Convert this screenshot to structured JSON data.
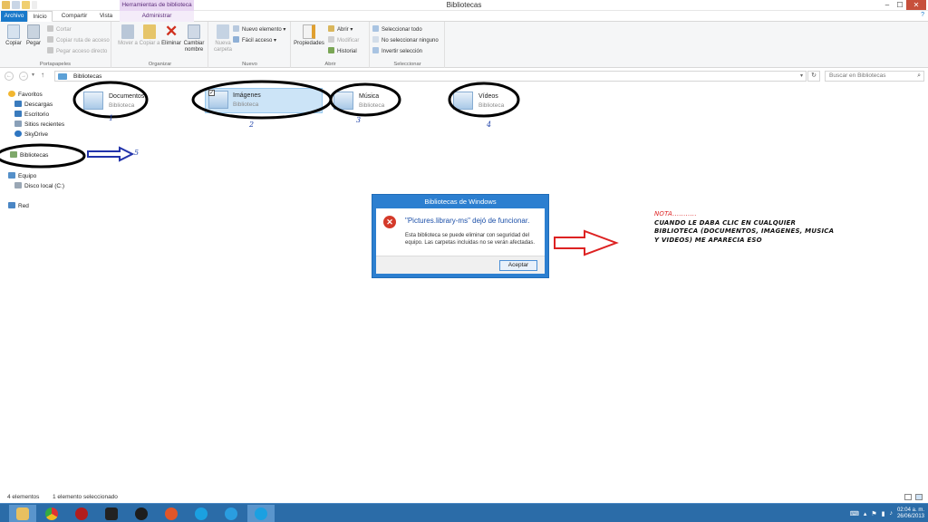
{
  "window": {
    "title": "Bibliotecas",
    "context_tab_header": "Herramientas de biblioteca",
    "minimize": "–",
    "maximize": "☐",
    "close": "✕"
  },
  "tabs": {
    "file": "Archivo",
    "home": "Inicio",
    "share": "Compartir",
    "view": "Vista",
    "manage": "Administrar",
    "help": "?"
  },
  "ribbon": {
    "clipboard": {
      "label": "Portapapeles",
      "copy": "Copiar",
      "paste": "Pegar",
      "cut": "Cortar",
      "copy_path": "Copiar ruta de acceso",
      "paste_shortcut": "Pegar acceso directo"
    },
    "organize": {
      "label": "Organizar",
      "move_to": "Mover a",
      "copy_to": "Copiar a",
      "delete": "Eliminar",
      "rename": "Cambiar nombre"
    },
    "new": {
      "label": "Nuevo",
      "new_folder": "Nueva carpeta",
      "new_item": "Nuevo elemento",
      "easy_access": "Fácil acceso"
    },
    "open": {
      "label": "Abrir",
      "properties": "Propiedades",
      "open": "Abrir",
      "edit": "Modificar",
      "history": "Historial"
    },
    "select": {
      "label": "Seleccionar",
      "select_all": "Seleccionar todo",
      "select_none": "No seleccionar ninguno",
      "invert": "Invertir selección"
    }
  },
  "address": {
    "path": "Bibliotecas",
    "search_placeholder": "Buscar en Bibliotecas"
  },
  "nav": {
    "favorites": "Favoritos",
    "downloads": "Descargas",
    "desktop": "Escritorio",
    "recent": "Sitios recientes",
    "skydrive": "SkyDrive",
    "libraries": "Bibliotecas",
    "computer": "Equipo",
    "local_disk": "Disco local (C:)",
    "network": "Red"
  },
  "libraries": [
    {
      "name": "Documentos",
      "type": "Biblioteca"
    },
    {
      "name": "Imágenes",
      "type": "Biblioteca"
    },
    {
      "name": "Música",
      "type": "Biblioteca"
    },
    {
      "name": "Vídeos",
      "type": "Biblioteca"
    }
  ],
  "annotations": {
    "n1": "1",
    "n2": "2",
    "n3": "3",
    "n4": "4",
    "n5": "5",
    "note_heading": "NOTA...........",
    "note_body": "CUANDO LE DABA CLIC EN CUALQUIER BIBLIOTECA (DOCUMENTOS, IMAGENES, MUSICA Y VIDEOS)  ME APARECIA ESO"
  },
  "dialog": {
    "title": "Bibliotecas de Windows",
    "main": "\"Pictures.library-ms\" dejó de funcionar.",
    "sub": "Esta biblioteca se puede eliminar con seguridad del equipo. Las carpetas incluidas no se verán afectadas.",
    "button": "Aceptar"
  },
  "status": {
    "count": "4 elementos",
    "selected": "1 elemento seleccionado"
  },
  "taskbar": {
    "time": "02:04 a. m.",
    "date": "26/06/2013"
  },
  "colors": {
    "accent": "#1979ca",
    "taskbar": "#2b6ca8",
    "annotation_ink": "#000000",
    "arrow_blue": "#2233aa",
    "arrow_red": "#dd2222"
  }
}
